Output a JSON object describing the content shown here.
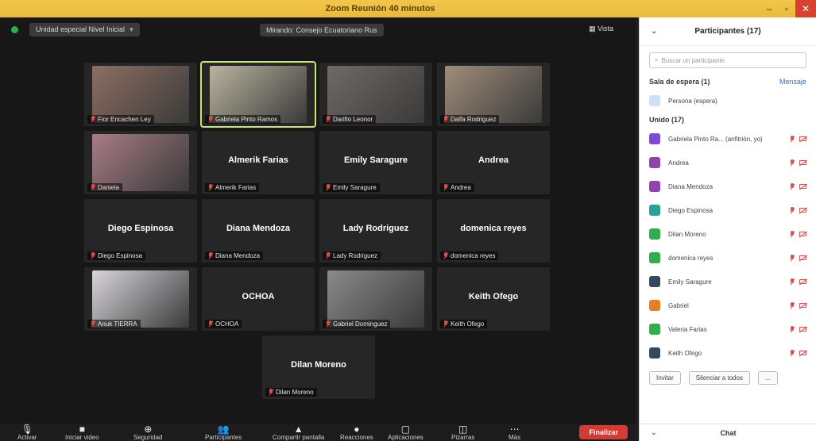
{
  "window": {
    "title": "Zoom Reunión 40 minutos"
  },
  "topbar": {
    "meeting_info": "Unidad especial Nivel Inicial",
    "speaker": "Mirando: Consejo Ecuatoriano Rus",
    "view_label": "Vista"
  },
  "tiles": [
    {
      "label": "Fior Encachen Ley",
      "center": "",
      "photo": "#8d6f62",
      "active": false
    },
    {
      "label": "Gabriela Pinto Ramos",
      "center": "",
      "photo": "#b9b39e",
      "active": true
    },
    {
      "label": "Darifio Leonor",
      "center": "",
      "photo": "#6f6a66",
      "active": false
    },
    {
      "label": "Dalfa Rodriguez",
      "center": "",
      "photo": "#a08d7a",
      "active": false
    },
    {
      "label": "Daniela",
      "center": "",
      "photo": "#a87c86",
      "active": false
    },
    {
      "label": "Almerik Farias",
      "center": "Almerik Farias",
      "photo": "",
      "active": false
    },
    {
      "label": "Emily Saragure",
      "center": "Emily Saragure",
      "photo": "",
      "active": false
    },
    {
      "label": "Andrea",
      "center": "Andrea",
      "photo": "",
      "active": false
    },
    {
      "label": "Diego Espinosa",
      "center": "Diego Espinosa",
      "photo": "",
      "active": false
    },
    {
      "label": "Diana Mendoza",
      "center": "Diana Mendoza",
      "photo": "",
      "active": false
    },
    {
      "label": "Lady Rodriguez",
      "center": "Lady Rodriguez",
      "photo": "",
      "active": false
    },
    {
      "label": "domenica reyes",
      "center": "domenica reyes",
      "photo": "",
      "active": false
    },
    {
      "label": "Anuk TIERRA",
      "center": "",
      "photo": "#d8d6db",
      "active": false
    },
    {
      "label": "OCHOA",
      "center": "OCHOA",
      "photo": "",
      "active": false
    },
    {
      "label": "Gabriel Dominguez",
      "center": "",
      "photo": "#8a8a8a",
      "active": false
    },
    {
      "label": "Keith Ofego",
      "center": "Keith Ofego",
      "photo": "",
      "active": false
    },
    {
      "label": "Dilan Moreno",
      "center": "Dilan Moreno",
      "photo": "",
      "active": false
    }
  ],
  "toolbar": {
    "items": [
      {
        "icon": "🎙",
        "label": "Activar"
      },
      {
        "icon": "■",
        "label": "Iniciar video"
      },
      {
        "icon": "⊕",
        "label": "Seguridad"
      },
      {
        "icon": "👥",
        "label": "Participantes"
      },
      {
        "icon": "▲",
        "label": "Compartir pantalla"
      },
      {
        "icon": "●",
        "label": "Reacciones"
      },
      {
        "icon": "▢",
        "label": "Aplicaciones"
      },
      {
        "icon": "◫",
        "label": "Pizarras"
      },
      {
        "icon": "⋯",
        "label": "Más"
      }
    ],
    "end_label": "Finalizar"
  },
  "panel": {
    "title": "Participantes (17)",
    "search_placeholder": "Buscar un participante",
    "waiting_section": "Sala de espera (1)",
    "waiting_action": "Mensaje",
    "waiting_person": "Persona (espera)",
    "joined_section": "Unido (17)",
    "participants": [
      {
        "name": "Gabriela Pinto Ra...  (anfitrión, yo)",
        "color": "#7e4bd6"
      },
      {
        "name": "Andrea",
        "color": "#8e44ad"
      },
      {
        "name": "Diana Mendoza",
        "color": "#8e44ad"
      },
      {
        "name": "Diego Espinosa",
        "color": "#2aa198"
      },
      {
        "name": "Dilan Moreno",
        "color": "#2fae4b"
      },
      {
        "name": "domenica reyes",
        "color": "#2fae4b"
      },
      {
        "name": "Emily Saragure",
        "color": "#34495e"
      },
      {
        "name": "Gabriel",
        "color": "#e67e22"
      },
      {
        "name": "Valeria Farias",
        "color": "#2fae4b"
      },
      {
        "name": "Keith Ofego",
        "color": "#34495e"
      }
    ],
    "invite_label": "Invitar",
    "mute_all_label": "Silenciar a todos",
    "more_label": "...",
    "chat_title": "Chat"
  }
}
